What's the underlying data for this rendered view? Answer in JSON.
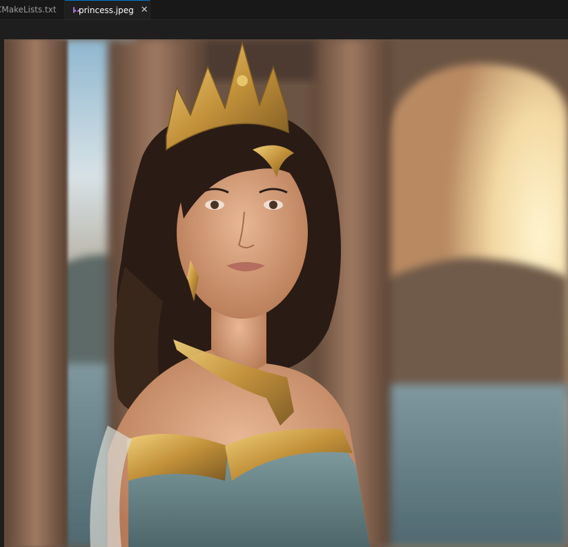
{
  "tabs": [
    {
      "label": "CMakeLists.txt",
      "active": false
    },
    {
      "label": "princess.jpeg",
      "active": true
    }
  ],
  "close_glyph": "✕",
  "viewer": {
    "subject": "portrait-photo",
    "colors": {
      "sky": "#9fc3d8",
      "sunlight": "#f4dba0",
      "pillar": "#8a6a55",
      "hair": "#2a1b14",
      "skin": "#d9a078",
      "gold": "#c99a3b",
      "dress": "#6f8c8f",
      "water": "#6f8890"
    }
  },
  "colors": {
    "tabbar_bg": "#181818",
    "active_tab_border": "#0078d4",
    "image_icon": "#a074c4"
  }
}
